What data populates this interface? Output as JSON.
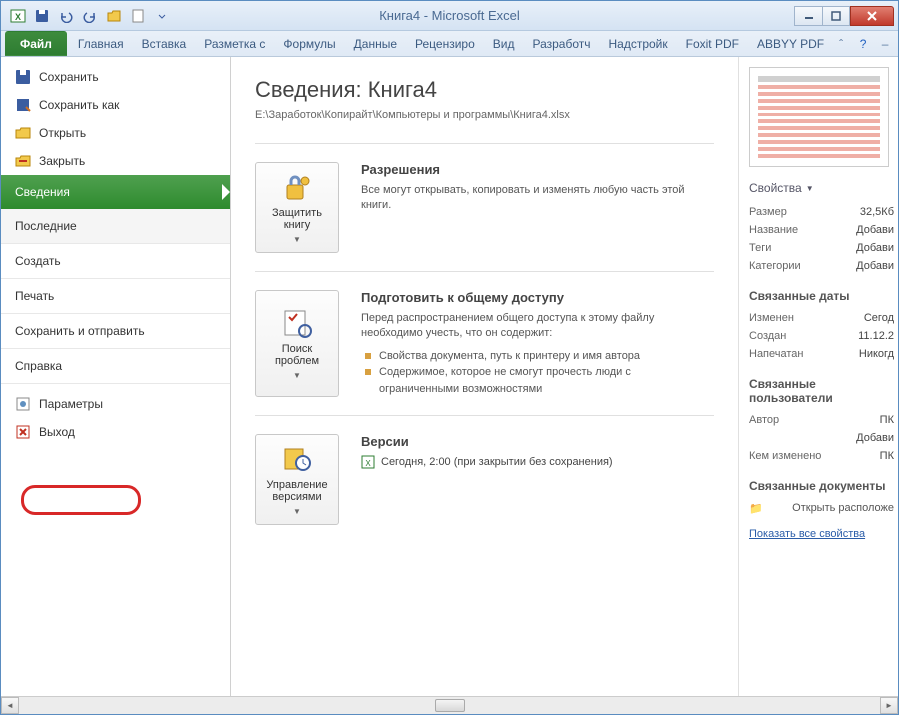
{
  "window": {
    "title": "Книга4 - Microsoft Excel"
  },
  "ribbon": {
    "file": "Файл",
    "tabs": [
      "Главная",
      "Вставка",
      "Разметка с",
      "Формулы",
      "Данные",
      "Рецензиро",
      "Вид",
      "Разработч",
      "Надстройк",
      "Foxit PDF",
      "ABBYY PDF"
    ]
  },
  "sidebar": {
    "save": "Сохранить",
    "save_as": "Сохранить как",
    "open": "Открыть",
    "close": "Закрыть",
    "info": "Сведения",
    "recent": "Последние",
    "new": "Создать",
    "print": "Печать",
    "send": "Сохранить и отправить",
    "help": "Справка",
    "options": "Параметры",
    "exit": "Выход"
  },
  "info": {
    "title": "Сведения: Книга4",
    "path": "E:\\Заработок\\Копирайт\\Компьютеры и программы\\Книга4.xlsx",
    "protect": {
      "btn": "Защитить книгу",
      "head": "Разрешения",
      "body": "Все могут открывать, копировать и изменять любую часть этой книги."
    },
    "check": {
      "btn": "Поиск проблем",
      "head": "Подготовить к общему доступу",
      "intro": "Перед распространением общего доступа к этому файлу необходимо учесть, что он содержит:",
      "items": [
        "Свойства документа, путь к принтеру и имя автора",
        "Содержимое, которое не смогут прочесть люди с ограниченными возможностями"
      ]
    },
    "versions": {
      "btn": "Управление версиями",
      "head": "Версии",
      "line": "Сегодня, 2:00 (при закрытии без сохранения)"
    }
  },
  "props": {
    "head": "Свойства",
    "rows": [
      {
        "k": "Размер",
        "v": "32,5Кб"
      },
      {
        "k": "Название",
        "v": "Добави"
      },
      {
        "k": "Теги",
        "v": "Добави"
      },
      {
        "k": "Категории",
        "v": "Добави"
      }
    ],
    "dates_head": "Связанные даты",
    "dates": [
      {
        "k": "Изменен",
        "v": "Сегод"
      },
      {
        "k": "Создан",
        "v": "11.12.2"
      },
      {
        "k": "Напечатан",
        "v": "Никогд"
      }
    ],
    "people_head": "Связанные пользователи",
    "people": [
      {
        "k": "Автор",
        "v": "ПК"
      },
      {
        "k": "",
        "v": "Добави"
      },
      {
        "k": "Кем изменено",
        "v": "ПК"
      }
    ],
    "docs_head": "Связанные документы",
    "open_loc": "Открыть расположе",
    "show_all": "Показать все свойства"
  }
}
